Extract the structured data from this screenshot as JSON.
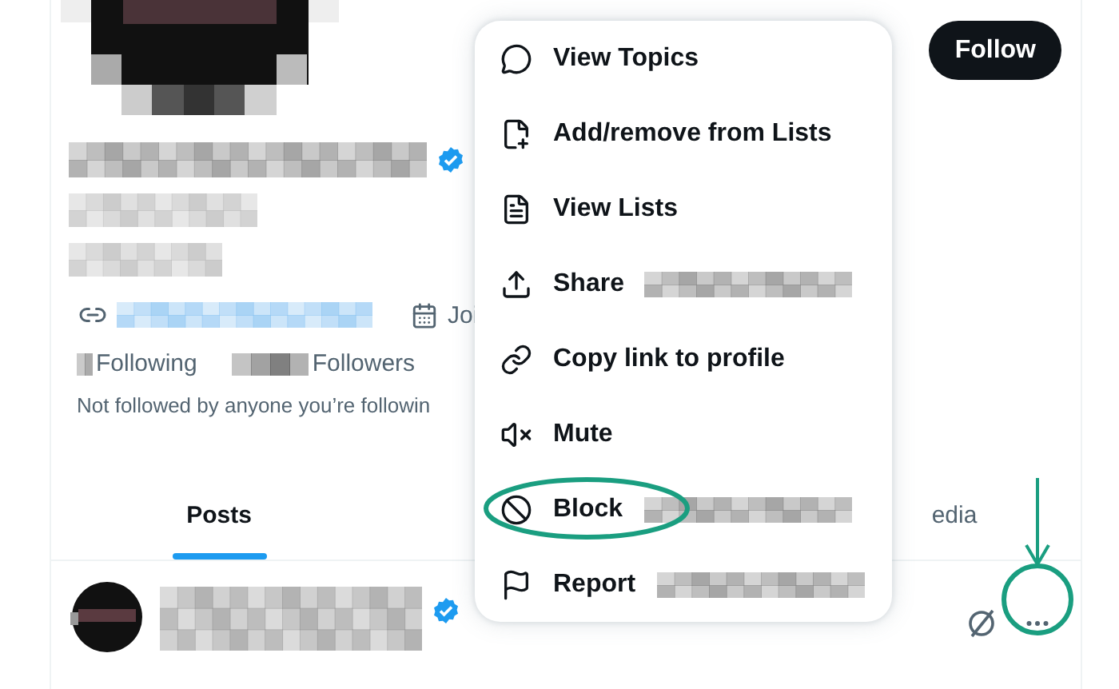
{
  "profile": {
    "follow_button": "Follow",
    "verified": true,
    "joined": "Joi",
    "following_label": "Following",
    "followers_label": "Followers",
    "followed_by": "Not followed by anyone you’re followin"
  },
  "tabs": [
    {
      "label": "Posts",
      "selected": true
    },
    {
      "label": "edia",
      "selected": false
    }
  ],
  "post": {
    "verified": true,
    "more_highlighted": true
  },
  "menu": [
    {
      "label": "View Topics",
      "redacted": false,
      "highlighted": false
    },
    {
      "label": "Add/remove from Lists",
      "redacted": false,
      "highlighted": false
    },
    {
      "label": "View Lists",
      "redacted": false,
      "highlighted": false
    },
    {
      "label": "Share",
      "redacted": true,
      "highlighted": false
    },
    {
      "label": "Copy link to profile",
      "redacted": false,
      "highlighted": false
    },
    {
      "label": "Mute",
      "redacted": false,
      "highlighted": false
    },
    {
      "label": "Block",
      "redacted": true,
      "highlighted": true
    },
    {
      "label": "Report",
      "redacted": true,
      "highlighted": false
    }
  ]
}
